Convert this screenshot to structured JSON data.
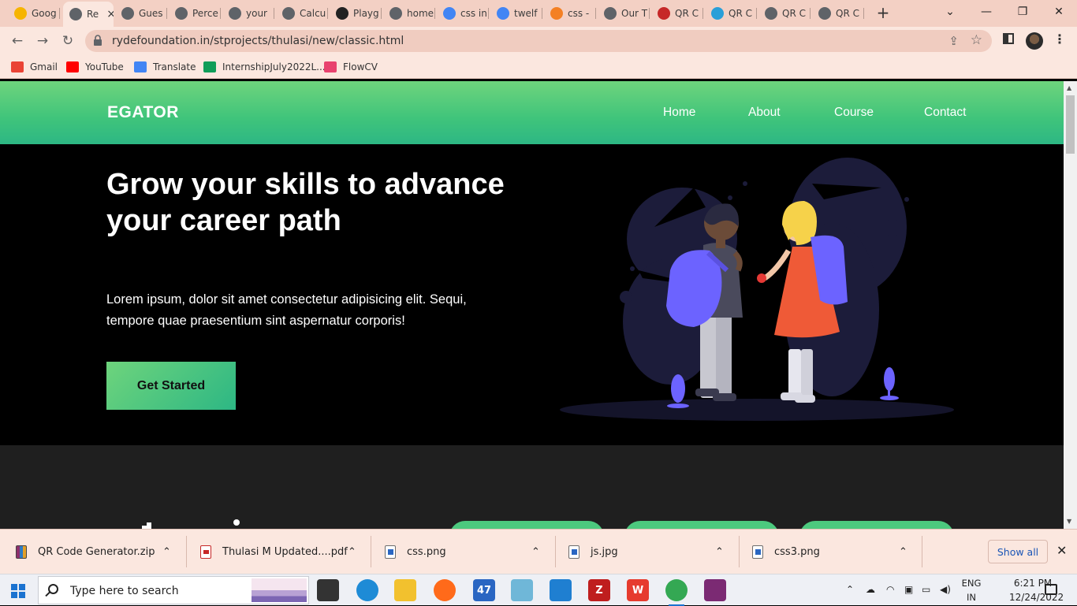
{
  "browser": {
    "tabs": [
      {
        "label": "Goog",
        "icon": "lightbulb-icon",
        "color": "#f6b400"
      },
      {
        "label": "Re",
        "icon": "globe-icon",
        "color": "#5f6368",
        "active": true
      },
      {
        "label": "Gues",
        "icon": "globe-icon",
        "color": "#5f6368"
      },
      {
        "label": "Perce",
        "icon": "globe-icon",
        "color": "#5f6368"
      },
      {
        "label": "your",
        "icon": "globe-icon",
        "color": "#5f6368"
      },
      {
        "label": "Calcu",
        "icon": "globe-icon",
        "color": "#5f6368"
      },
      {
        "label": "Playg",
        "icon": "openai-icon",
        "color": "#222222"
      },
      {
        "label": "home",
        "icon": "globe-icon",
        "color": "#5f6368"
      },
      {
        "label": "css in",
        "icon": "google-icon",
        "color": "#4285f4"
      },
      {
        "label": "twelf",
        "icon": "google-icon",
        "color": "#4285f4"
      },
      {
        "label": "css -",
        "icon": "stackoverflow-icon",
        "color": "#f48024"
      },
      {
        "label": "Our T",
        "icon": "globe-icon",
        "color": "#5f6368"
      },
      {
        "label": "QR C",
        "icon": "runner-icon",
        "color": "#c62828"
      },
      {
        "label": "QR C",
        "icon": "cn-icon",
        "color": "#2a9fd8"
      },
      {
        "label": "QR C",
        "icon": "globe-icon",
        "color": "#5f6368"
      },
      {
        "label": "QR C",
        "icon": "globe-icon",
        "color": "#5f6368"
      }
    ],
    "tab_close": "×",
    "new_tab": "+",
    "tab_search": "⌄",
    "minimize": "—",
    "maximize": "❐",
    "close": "✕",
    "url": "rydefoundation.in/stprojects/thulasi/new/classic.html",
    "back": "←",
    "forward": "→",
    "reload": "↻",
    "share": "⇪",
    "star": "☆",
    "menu": "⋮",
    "bookmarks": [
      {
        "label": "Gmail",
        "icon": "gmail-icon",
        "color": "#ea4335"
      },
      {
        "label": "YouTube",
        "icon": "youtube-icon",
        "color": "#ff0000"
      },
      {
        "label": "Translate",
        "icon": "translate-icon",
        "color": "#4285f4"
      },
      {
        "label": "InternshipJuly2022L...",
        "icon": "sheets-icon",
        "color": "#0f9d58"
      },
      {
        "label": "FlowCV",
        "icon": "flowcv-icon",
        "color": "#e8426e"
      }
    ]
  },
  "site": {
    "logo": "EGATOR",
    "nav": [
      "Home",
      "About",
      "Course",
      "Contact"
    ],
    "hero_title": "Grow your skills to advance your career path",
    "hero_text": "Lorem ipsum, dolor sit amet consectetur adipisicing elit. Sequi, tempore quae praesentium sint aspernatur corporis!",
    "cta": "Get Started",
    "brand_gradient": [
      "#6ed47c",
      "#2db784"
    ],
    "hero_bg": "#000000",
    "section_bg": "#1f1f1f"
  },
  "downloads": {
    "items": [
      {
        "name": "QR Code Generator.zip",
        "icon": "zip-icon"
      },
      {
        "name": "Thulasi M Updated....pdf",
        "icon": "pdf-icon"
      },
      {
        "name": "css.png",
        "icon": "image-file-icon"
      },
      {
        "name": "js.jpg",
        "icon": "image-file-icon"
      },
      {
        "name": "css3.png",
        "icon": "image-file-icon"
      }
    ],
    "chevron": "⌃",
    "show_all": "Show all",
    "close": "✕"
  },
  "taskbar": {
    "search_placeholder": "Type here to search",
    "apps": [
      {
        "icon": "task-view-icon",
        "label": "",
        "color": "#333333"
      },
      {
        "icon": "edge-icon",
        "label": "",
        "color": "#1e8bd6"
      },
      {
        "icon": "file-explorer-icon",
        "label": "",
        "color": "#f2c12e"
      },
      {
        "icon": "firefox-icon",
        "label": "",
        "color": "#ff6a1a"
      },
      {
        "icon": "mail-icon",
        "label": "47",
        "color": "#2a66c2"
      },
      {
        "icon": "notes-icon",
        "label": "",
        "color": "#6fb7d8"
      },
      {
        "icon": "vscode-icon",
        "label": "",
        "color": "#1f7fd1"
      },
      {
        "icon": "filezilla-icon",
        "label": "Z",
        "color": "#bf1e1e"
      },
      {
        "icon": "wps-icon",
        "label": "W",
        "color": "#e63b2e"
      },
      {
        "icon": "chrome-icon",
        "label": "",
        "color": "#34a853"
      },
      {
        "icon": "winrar-icon",
        "label": "",
        "color": "#7b2a73"
      }
    ],
    "tray_chevron": "⌃",
    "lang_line1": "ENG",
    "lang_line2": "IN",
    "time": "6:21 PM",
    "date": "12/24/2022"
  }
}
